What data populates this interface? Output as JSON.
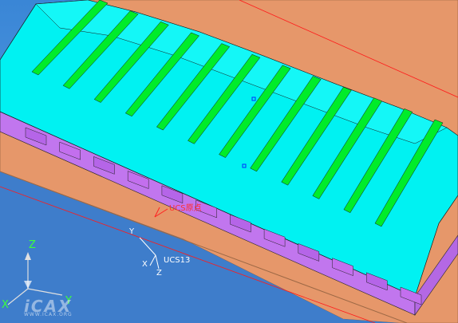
{
  "viewport": {
    "ucs_origin_label": "UCS原点",
    "ucs_name": "UCS13",
    "ucs_axes": {
      "x": "X",
      "y": "Y",
      "z": "Z"
    },
    "world_axes": {
      "x": "X",
      "y": "Y",
      "z": "Z"
    },
    "watermark": {
      "text": "iCAX",
      "url": "WWW.ICAX.ORG"
    }
  },
  "colors": {
    "background": "#3f86d6",
    "base_plate": "#e89a68",
    "cavity_faces": "#00ffff",
    "rib_faces": "#00ee2a",
    "side_walls": "#c070ee",
    "edges": "#1a1a1a",
    "selection_box": "#ff0000"
  }
}
